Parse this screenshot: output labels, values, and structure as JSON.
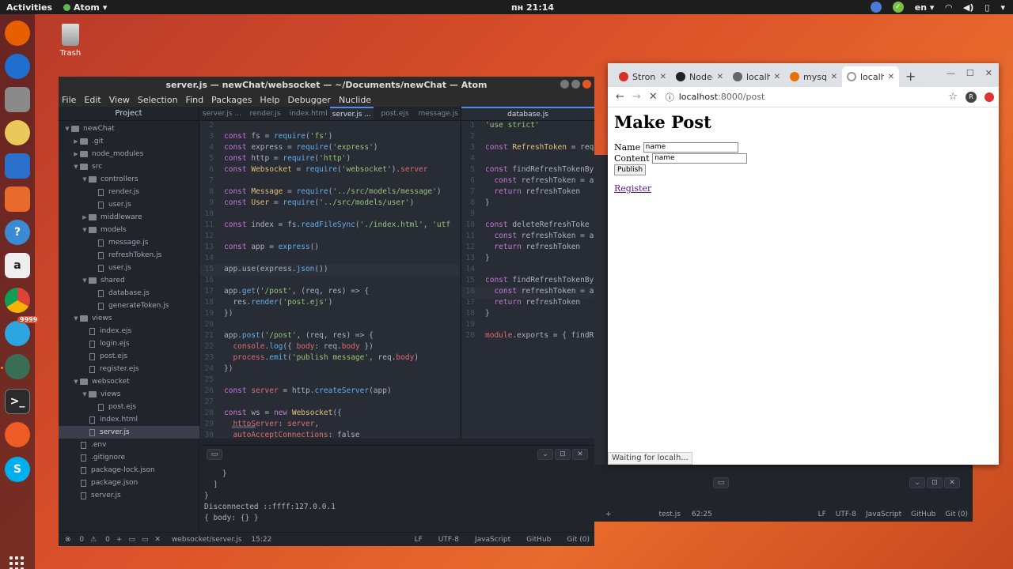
{
  "topbar": {
    "activities": "Activities",
    "app_name": "Atom",
    "clock": "пн 21:14",
    "lang": "en",
    "icons": [
      "notification-icon",
      "check-icon",
      "wifi-icon",
      "volume-icon",
      "battery-icon"
    ]
  },
  "desktop": {
    "trash_label": "Trash"
  },
  "dock": {
    "items": [
      "firefox-icon",
      "thunderbird-icon",
      "files-icon",
      "rhythmbox-icon",
      "libreoffice-writer-icon",
      "software-icon",
      "help-icon",
      "amazon-icon",
      "chrome-icon",
      "telegram-icon",
      "atom-icon",
      "terminal-icon",
      "postman-icon",
      "skype-icon"
    ],
    "telegram_badge": "9999"
  },
  "atom": {
    "title": "server.js — newChat/websocket — ~/Documents/newChat — Atom",
    "menu": [
      "File",
      "Edit",
      "View",
      "Selection",
      "Find",
      "Packages",
      "Help",
      "Debugger",
      "Nuclide"
    ],
    "tree_header": "Project",
    "tree": [
      {
        "label": "newChat",
        "depth": 0,
        "type": "folder",
        "open": true
      },
      {
        "label": ".git",
        "depth": 1,
        "type": "folder",
        "open": false
      },
      {
        "label": "node_modules",
        "depth": 1,
        "type": "folder",
        "open": false
      },
      {
        "label": "src",
        "depth": 1,
        "type": "folder",
        "open": true
      },
      {
        "label": "controllers",
        "depth": 2,
        "type": "folder",
        "open": true
      },
      {
        "label": "render.js",
        "depth": 3,
        "type": "file"
      },
      {
        "label": "user.js",
        "depth": 3,
        "type": "file"
      },
      {
        "label": "middleware",
        "depth": 2,
        "type": "folder",
        "open": false
      },
      {
        "label": "models",
        "depth": 2,
        "type": "folder",
        "open": true
      },
      {
        "label": "message.js",
        "depth": 3,
        "type": "file"
      },
      {
        "label": "refreshToken.js",
        "depth": 3,
        "type": "file"
      },
      {
        "label": "user.js",
        "depth": 3,
        "type": "file"
      },
      {
        "label": "shared",
        "depth": 2,
        "type": "folder",
        "open": true
      },
      {
        "label": "database.js",
        "depth": 3,
        "type": "file"
      },
      {
        "label": "generateToken.js",
        "depth": 3,
        "type": "file"
      },
      {
        "label": "views",
        "depth": 1,
        "type": "folder",
        "open": true
      },
      {
        "label": "index.ejs",
        "depth": 2,
        "type": "file"
      },
      {
        "label": "login.ejs",
        "depth": 2,
        "type": "file"
      },
      {
        "label": "post.ejs",
        "depth": 2,
        "type": "file"
      },
      {
        "label": "register.ejs",
        "depth": 2,
        "type": "file"
      },
      {
        "label": "websocket",
        "depth": 1,
        "type": "folder",
        "open": true
      },
      {
        "label": "views",
        "depth": 2,
        "type": "folder",
        "open": true
      },
      {
        "label": "post.ejs",
        "depth": 3,
        "type": "file"
      },
      {
        "label": "index.html",
        "depth": 2,
        "type": "file"
      },
      {
        "label": "server.js",
        "depth": 2,
        "type": "file",
        "selected": true
      },
      {
        "label": ".env",
        "depth": 1,
        "type": "file"
      },
      {
        "label": ".gitignore",
        "depth": 1,
        "type": "file"
      },
      {
        "label": "package-lock.json",
        "depth": 1,
        "type": "file"
      },
      {
        "label": "package.json",
        "depth": 1,
        "type": "file"
      },
      {
        "label": "server.js",
        "depth": 1,
        "type": "file"
      }
    ],
    "tabs_left": [
      "server.js ...",
      "render.js",
      "index.html",
      "server.js ...",
      "post.ejs",
      "message.js"
    ],
    "active_tab_index": 3,
    "tabs_right": [
      "database.js"
    ],
    "code_left": [
      {
        "n": "2",
        "t": ""
      },
      {
        "n": "3",
        "t": "const fs = require('fs')"
      },
      {
        "n": "4",
        "t": "const express = require('express')"
      },
      {
        "n": "5",
        "t": "const http = require('http')"
      },
      {
        "n": "6",
        "t": "const Websocket = require('websocket').server"
      },
      {
        "n": "7",
        "t": ""
      },
      {
        "n": "8",
        "t": "const Message = require('../src/models/message')"
      },
      {
        "n": "9",
        "t": "const User = require('../src/models/user')"
      },
      {
        "n": "10",
        "t": ""
      },
      {
        "n": "11",
        "t": "const index = fs.readFileSync('./index.html', 'utf"
      },
      {
        "n": "12",
        "t": ""
      },
      {
        "n": "13",
        "t": "const app = express()"
      },
      {
        "n": "14",
        "t": ""
      },
      {
        "n": "15",
        "t": "app.use(express.json())",
        "cursor": true
      },
      {
        "n": "16",
        "t": ""
      },
      {
        "n": "17",
        "t": "app.get('/post', (req, res) => {"
      },
      {
        "n": "18",
        "t": "  res.render('post.ejs')"
      },
      {
        "n": "19",
        "t": "})"
      },
      {
        "n": "20",
        "t": ""
      },
      {
        "n": "21",
        "t": "app.post('/post', (req, res) => {"
      },
      {
        "n": "22",
        "t": "  console.log({ body: req.body })"
      },
      {
        "n": "23",
        "t": "  process.emit('publish message', req.body)"
      },
      {
        "n": "24",
        "t": "})"
      },
      {
        "n": "25",
        "t": ""
      },
      {
        "n": "26",
        "t": "const server = http.createServer(app)"
      },
      {
        "n": "27",
        "t": ""
      },
      {
        "n": "28",
        "t": "const ws = new Websocket({"
      },
      {
        "n": "29",
        "t": "  httpServer: server,"
      },
      {
        "n": "30",
        "t": "  autoAcceptConnections: false"
      }
    ],
    "code_right": [
      {
        "n": "1",
        "t": "'use strict'"
      },
      {
        "n": "2",
        "t": ""
      },
      {
        "n": "3",
        "t": "const RefreshToken = req"
      },
      {
        "n": "4",
        "t": ""
      },
      {
        "n": "5",
        "t": "const findRefreshTokenBy"
      },
      {
        "n": "6",
        "t": "  const refreshToken = a"
      },
      {
        "n": "7",
        "t": "  return refreshToken"
      },
      {
        "n": "8",
        "t": "}"
      },
      {
        "n": "9",
        "t": ""
      },
      {
        "n": "10",
        "t": "const deleteRefreshToke"
      },
      {
        "n": "11",
        "t": "  const refreshToken = a"
      },
      {
        "n": "12",
        "t": "  return refreshToken"
      },
      {
        "n": "13",
        "t": "}"
      },
      {
        "n": "14",
        "t": ""
      },
      {
        "n": "15",
        "t": "const findRefreshTokenBy"
      },
      {
        "n": "16",
        "t": "  const refreshToken = a",
        "cursor": true
      },
      {
        "n": "17",
        "t": "  return refreshToken"
      },
      {
        "n": "18",
        "t": "}"
      },
      {
        "n": "19",
        "t": ""
      },
      {
        "n": "20",
        "t": "module.exports = { findR"
      }
    ],
    "console_lines": [
      "    }",
      "  ]",
      "}",
      "Disconnected ::ffff:127.0.0.1",
      "{ body: {} }"
    ],
    "status": {
      "errors": "0",
      "warnings": "0",
      "path": "websocket/server.js",
      "position": "15:22",
      "line_ending": "LF",
      "encoding": "UTF-8",
      "grammar": "JavaScript",
      "github": "GitHub",
      "git": "Git (0)"
    }
  },
  "atom2": {
    "file": "test.js",
    "position": "62:25",
    "line_ending": "LF",
    "encoding": "UTF-8",
    "grammar": "JavaScript",
    "github": "GitHub",
    "git": "Git (0)"
  },
  "chrome": {
    "tabs": [
      {
        "label": "Strong",
        "favicon": "gmail-icon",
        "color": "#d93025"
      },
      {
        "label": "Node-",
        "favicon": "github-icon",
        "color": "#222222"
      },
      {
        "label": "localh",
        "favicon": "globe-icon",
        "color": "#666666"
      },
      {
        "label": "mysql",
        "favicon": "pencil-icon",
        "color": "#e8710a"
      },
      {
        "label": "localh",
        "favicon": "loading-icon",
        "color": "#999999",
        "active": true
      }
    ],
    "url_host": "localhost",
    "url_path": ":8000/post",
    "profile_initial": "R",
    "page": {
      "heading": "Make Post",
      "name_label": "Name",
      "name_value": "name",
      "content_label": "Content",
      "content_value": "name",
      "publish_label": "Publish",
      "register_link": "Register"
    },
    "status_text": "Waiting for localh..."
  }
}
